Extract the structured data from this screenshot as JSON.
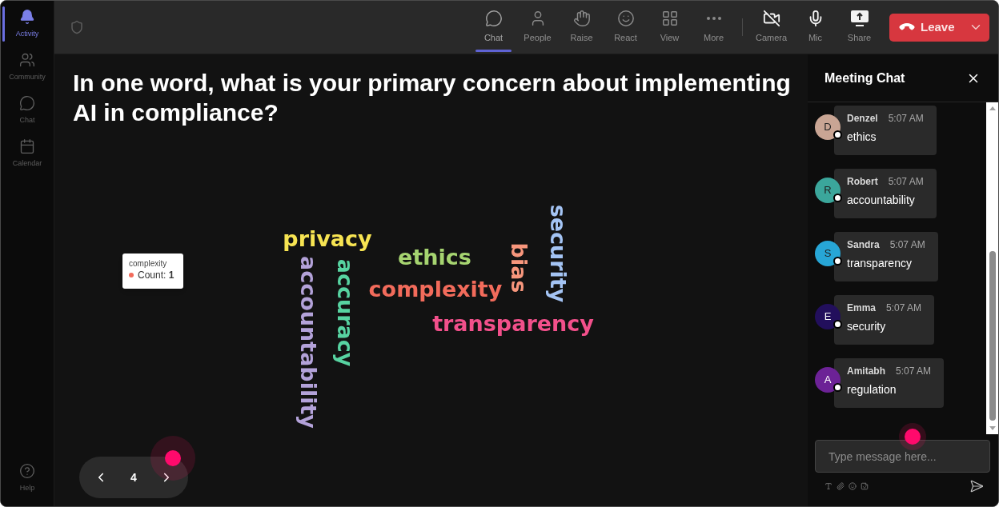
{
  "sidebar": {
    "items": [
      {
        "label": "Activity",
        "selected": true
      },
      {
        "label": "Community",
        "selected": false
      },
      {
        "label": "Chat",
        "selected": false
      },
      {
        "label": "Calendar",
        "selected": false
      }
    ],
    "help": {
      "label": "Help"
    }
  },
  "toolbar": {
    "meeting_controls": [
      {
        "label": "Chat",
        "selected": true
      },
      {
        "label": "People",
        "selected": false
      },
      {
        "label": "Raise",
        "selected": false
      },
      {
        "label": "React",
        "selected": false
      },
      {
        "label": "View",
        "selected": false
      },
      {
        "label": "More",
        "selected": false
      }
    ],
    "device_controls": [
      {
        "label": "Camera"
      },
      {
        "label": "Mic"
      },
      {
        "label": "Share"
      }
    ],
    "leave_button": {
      "label": "Leave"
    }
  },
  "question": "In one word, what is your primary concern about implementing AI in compliance?",
  "word_cloud": {
    "words": [
      {
        "text": "privacy",
        "color": "#f7e452",
        "rotated": false
      },
      {
        "text": "ethics",
        "color": "#a6d470",
        "rotated": false
      },
      {
        "text": "complexity",
        "color": "#f26b5b",
        "rotated": false
      },
      {
        "text": "transparency",
        "color": "#f2508b",
        "rotated": false
      },
      {
        "text": "bias",
        "color": "#f7967c",
        "rotated": true
      },
      {
        "text": "security",
        "color": "#a4c4f4",
        "rotated": true
      },
      {
        "text": "accountability",
        "color": "#b3a2d9",
        "rotated": true
      },
      {
        "text": "accuracy",
        "color": "#57d3a1",
        "rotated": true
      }
    ],
    "tooltip": {
      "title": "complexity",
      "text": "Count: **1**"
    }
  },
  "pager": {
    "page": "4"
  },
  "chat": {
    "title": "Meeting Chat",
    "messages": [
      {
        "initial": "D",
        "color": "#c9a594",
        "name": "Denzel",
        "time": "5:07 AM",
        "text": "ethics"
      },
      {
        "initial": "R",
        "color": "#3ba69b",
        "name": "Robert",
        "time": "5:07 AM",
        "text": "accountability"
      },
      {
        "initial": "S",
        "color": "#27a6d6",
        "name": "Sandra",
        "time": "5:07 AM",
        "text": "transparency"
      },
      {
        "initial": "E",
        "color": "#220f5c",
        "name": "Emma",
        "time": "5:07 AM",
        "text": "security"
      },
      {
        "initial": "A",
        "color": "#6c2296",
        "name": "Amitabh",
        "time": "5:07 AM",
        "text": "regulation"
      }
    ],
    "input": {
      "placeholder": "Type message here..."
    }
  }
}
